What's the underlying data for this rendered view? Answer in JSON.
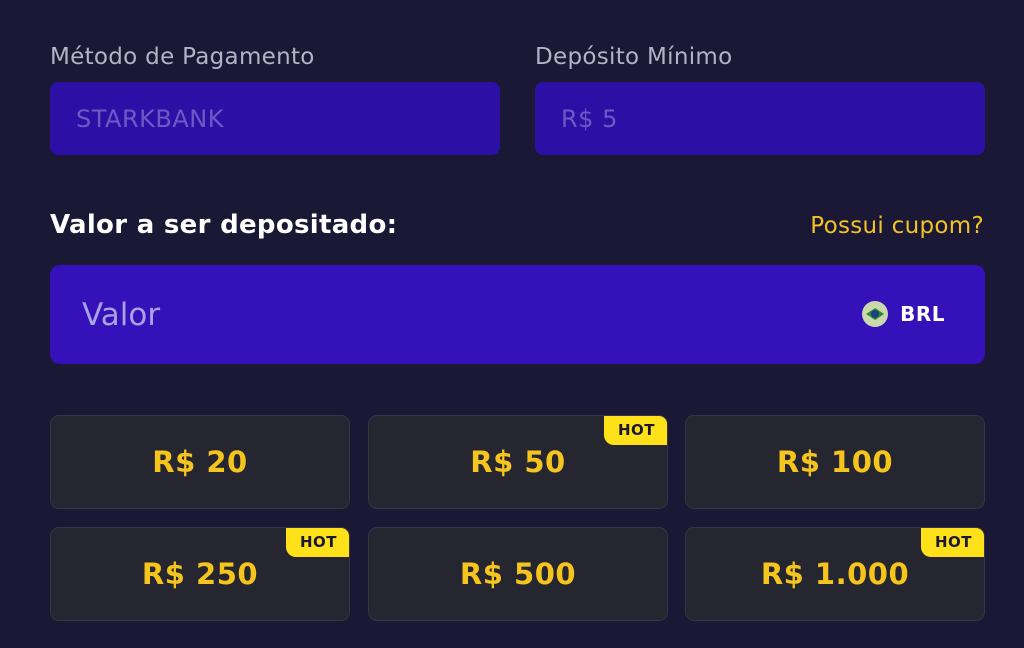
{
  "payment_method": {
    "label": "Método de Pagamento",
    "value": "STARKBANK"
  },
  "minimum_deposit": {
    "label": "Depósito Mínimo",
    "value": "R$ 5"
  },
  "amount": {
    "heading": "Valor a ser depositado:",
    "coupon_link": "Possui cupom?",
    "placeholder": "Valor",
    "value": "",
    "currency": "BRL",
    "currency_icon": "brazil-flag-icon"
  },
  "presets": [
    {
      "label": "R$ 20",
      "badge": ""
    },
    {
      "label": "R$ 50",
      "badge": "HOT"
    },
    {
      "label": "R$ 100",
      "badge": ""
    },
    {
      "label": "R$ 250",
      "badge": "HOT"
    },
    {
      "label": "R$ 500",
      "badge": ""
    },
    {
      "label": "R$ 1.000",
      "badge": "HOT"
    }
  ],
  "colors": {
    "background": "#1a1835",
    "field": "#2c10a6",
    "input": "#3511ba",
    "accent": "#f5c51e",
    "badge": "#ffe11a",
    "preset": "#262631"
  }
}
